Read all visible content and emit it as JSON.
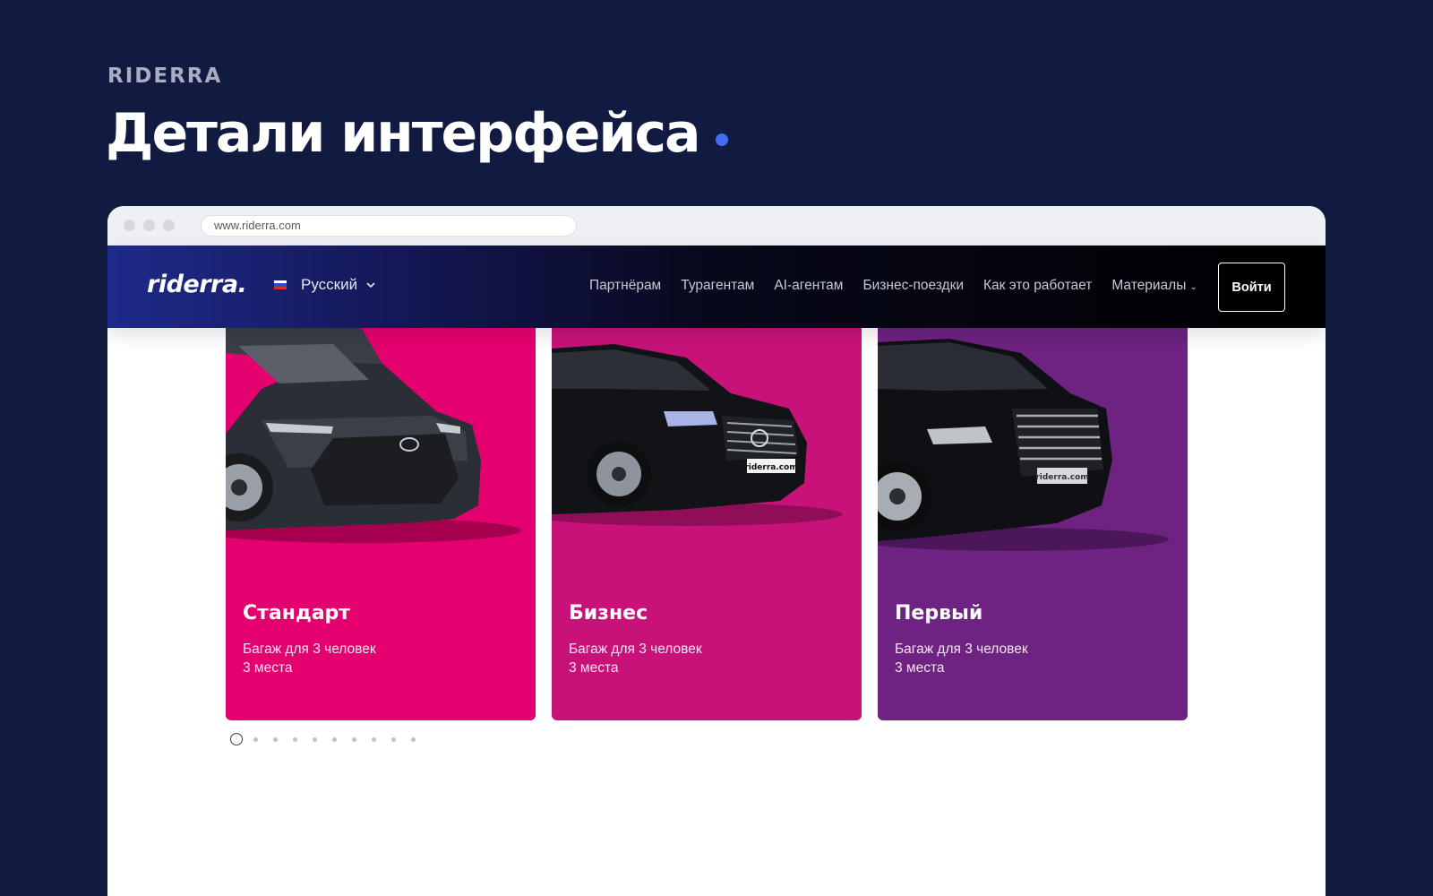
{
  "kicker": "RIDERRA",
  "headline": "Детали интерфейса",
  "browser": {
    "url": "www.riderra.com"
  },
  "navbar": {
    "logo": "riderra.",
    "language": "Русский",
    "links": [
      {
        "label": "Партнёрам"
      },
      {
        "label": "Турагентам"
      },
      {
        "label": "AI-агентам"
      },
      {
        "label": "Бизнес-поездки"
      },
      {
        "label": "Как это работает"
      },
      {
        "label": "Материалы",
        "has_dropdown": true
      }
    ],
    "login_label": "Войти"
  },
  "cards": [
    {
      "title": "Стандарт",
      "line1": "Багаж для 3 человек",
      "line2": "3 места",
      "color": "#e5006f"
    },
    {
      "title": "Бизнес",
      "line1": "Багаж для 3 человек",
      "line2": "3 места",
      "color": "#c8127a"
    },
    {
      "title": "Первый",
      "line1": "Багаж для 3 человек",
      "line2": "3 места",
      "color": "#6e2282"
    }
  ],
  "pager": {
    "total": 10,
    "active": 1
  },
  "colors": {
    "page_bg": "#111a41",
    "accent_dot": "#3f6ef0"
  },
  "icons": {
    "flag": "russia-flag-icon",
    "chevron": "chevron-down-icon"
  }
}
